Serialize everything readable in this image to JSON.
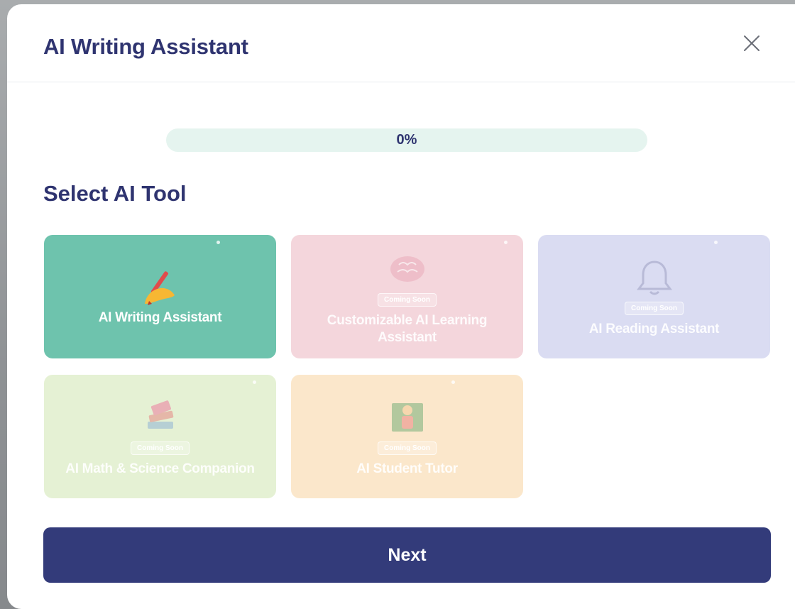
{
  "dialog": {
    "title": "AI Writing Assistant",
    "close_icon": "close-icon"
  },
  "progress": {
    "value_percent": 0,
    "label": "0%"
  },
  "section": {
    "title": "Select AI Tool"
  },
  "tools": [
    {
      "label": "AI Writing Assistant",
      "icon": "writing-hand-icon",
      "badge": "",
      "selected": true,
      "color": "#6ec3ad"
    },
    {
      "label": "Customizable AI Learning Assistant",
      "icon": "brain-icon",
      "badge": "Coming Soon",
      "selected": false,
      "color": "#f4d6dc"
    },
    {
      "label": "AI Reading Assistant",
      "icon": "bell-icon",
      "badge": "Coming Soon",
      "selected": false,
      "color": "#dadcf2"
    },
    {
      "label": "AI Math & Science Companion",
      "icon": "books-icon",
      "badge": "Coming Soon",
      "selected": false,
      "color": "#e5f1d4"
    },
    {
      "label": "AI Student Tutor",
      "icon": "student-icon",
      "badge": "Coming Soon",
      "selected": false,
      "color": "#fbe7cb"
    }
  ],
  "footer": {
    "next_label": "Next"
  },
  "colors": {
    "primary": "#333b7a",
    "heading": "#2f3470",
    "progress_track": "#e5f4ef",
    "accent": "#6ec3ad"
  }
}
